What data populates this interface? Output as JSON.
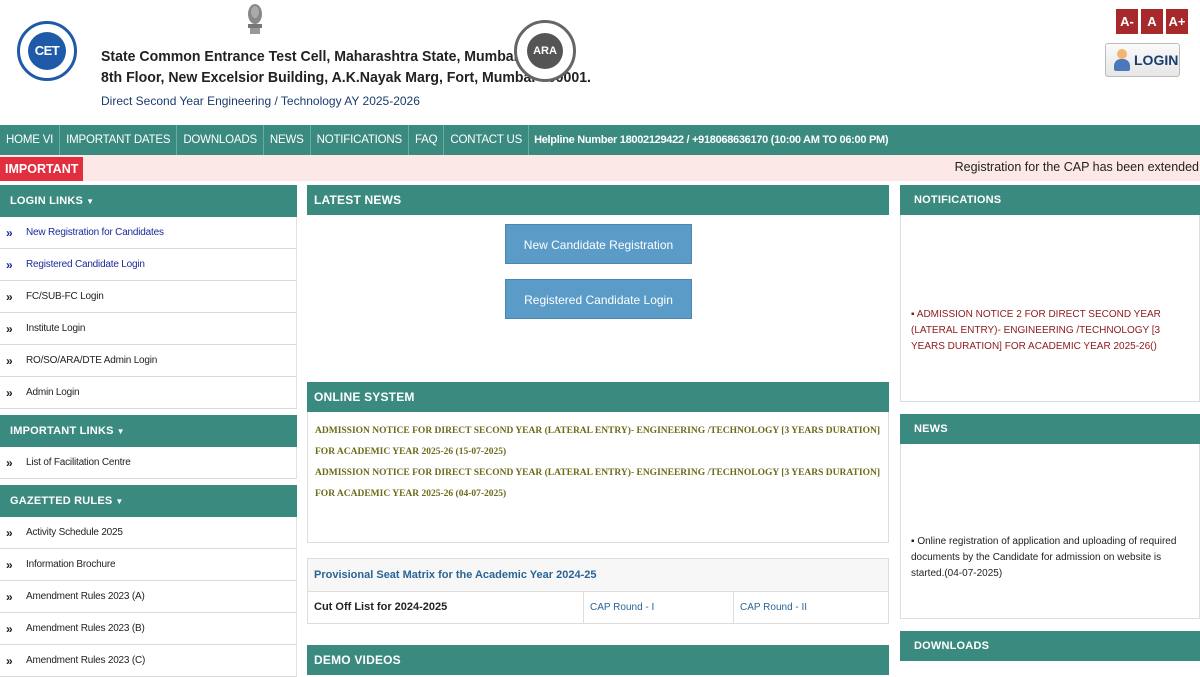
{
  "header": {
    "cet_logo_text": "CET",
    "ara_logo_text": "ARA",
    "line1": "State Common Entrance Test Cell, Maharashtra State, Mumbai",
    "line2": "8th Floor, New Excelsior Building, A.K.Nayak Marg, Fort, Mumbai-400001.",
    "line3": "Direct Second Year Engineering / Technology AY 2025-2026",
    "font_small": "A-",
    "font_normal": "A",
    "font_large": "A+",
    "login_label": "LOGIN"
  },
  "nav": {
    "items": [
      "HOME VI",
      "IMPORTANT DATES",
      "DOWNLOADS",
      "NEWS",
      "NOTIFICATIONS",
      "FAQ",
      "CONTACT US"
    ],
    "helpline": "Helpline Number 18002129422 / +918068636170 (10:00 AM TO 06:00 PM)"
  },
  "ticker": {
    "tag": "IMPORTANT",
    "message": "Registration for the CAP has been extended"
  },
  "sidebar": {
    "login_links": {
      "title": "LOGIN LINKS",
      "items": [
        "New Registration for Candidates",
        "Registered Candidate Login",
        "FC/SUB-FC Login",
        "Institute Login",
        "RO/SO/ARA/DTE Admin Login",
        "Admin Login"
      ]
    },
    "important_links": {
      "title": "IMPORTANT LINKS",
      "items": [
        "List of Facilitation Centre"
      ]
    },
    "gazetted_rules": {
      "title": "GAZETTED RULES",
      "items": [
        "Activity Schedule 2025",
        "Information Brochure",
        "Amendment Rules 2023 (A)",
        "Amendment Rules 2023 (B)",
        "Amendment Rules 2023 (C)"
      ]
    }
  },
  "latest_news": {
    "title": "LATEST NEWS",
    "new_reg_button": "New Candidate Registration",
    "reg_login_button": "Registered Candidate Login"
  },
  "online_system": {
    "title": "ONLINE SYSTEM",
    "notices": [
      "ADMISSION NOTICE FOR DIRECT SECOND YEAR (LATERAL ENTRY)- ENGINEERING /TECHNOLOGY [3 YEARS DURATION] FOR ACADEMIC YEAR 2025-26 (15-07-2025)",
      "ADMISSION NOTICE FOR DIRECT SECOND YEAR (LATERAL ENTRY)- ENGINEERING /TECHNOLOGY [3 YEARS DURATION] FOR ACADEMIC YEAR 2025-26 (04-07-2025)"
    ]
  },
  "seat_matrix": {
    "title": "Provisional Seat Matrix for the Academic Year 2024-25",
    "row_label": "Cut Off List for 2024-2025",
    "round1": "CAP Round - I",
    "round2": "CAP Round - II"
  },
  "demo_videos": {
    "title": "DEMO VIDEOS"
  },
  "notifications": {
    "title": "NOTIFICATIONS",
    "items": [
      "ADMISSION NOTICE 2 FOR DIRECT SECOND YEAR (LATERAL ENTRY)- ENGINEERING /TECHNOLOGY [3 YEARS DURATION] FOR ACADEMIC YEAR 2025-26()"
    ]
  },
  "news": {
    "title": "NEWS",
    "items": [
      "Online registration of application and uploading of required documents by the Candidate for admission on website is started.(04-07-2025)"
    ]
  },
  "downloads": {
    "title": "DOWNLOADS"
  },
  "colors": {
    "teal": "#3a8a80",
    "maroon": "#a8292c",
    "important_red": "#e22f3f",
    "ticker_bg": "#fde8e8",
    "button_blue": "#5b9bc7",
    "notice_olive": "#6b6b1a",
    "link_blue": "#2a6496"
  }
}
